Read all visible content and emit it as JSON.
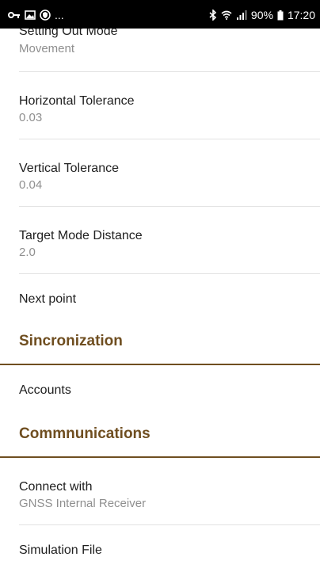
{
  "status_bar": {
    "left_icons": [
      "vpn-key-icon",
      "image-icon",
      "shield-icon"
    ],
    "ellipsis": "...",
    "bluetooth": "bluetooth-icon",
    "wifi": "wifi-icon",
    "signal": "signal-icon",
    "battery_text": "90%",
    "battery_icon": "battery-icon",
    "time": "17:20"
  },
  "settings": {
    "setting_out_mode": {
      "title": "Setting Out Mode",
      "value": "Movement"
    },
    "horizontal_tolerance": {
      "title": "Horizontal Tolerance",
      "value": "0.03"
    },
    "vertical_tolerance": {
      "title": "Vertical Tolerance",
      "value": "0.04"
    },
    "target_mode_distance": {
      "title": "Target Mode Distance",
      "value": "2.0"
    },
    "next_point": {
      "title": "Next point"
    }
  },
  "sections": {
    "sync": {
      "title": "Sincronization"
    },
    "communications": {
      "title": "Commnunications"
    }
  },
  "sync_items": {
    "accounts": {
      "title": "Accounts"
    }
  },
  "comm_items": {
    "connect_with": {
      "title": "Connect with",
      "value": "GNSS Internal Receiver"
    },
    "simulation_file": {
      "title": "Simulation File"
    }
  },
  "colors": {
    "section_accent": "#6f4e20",
    "divider": "#e2e2e2",
    "secondary_text": "#8f8f8f",
    "primary_text": "#202020"
  }
}
